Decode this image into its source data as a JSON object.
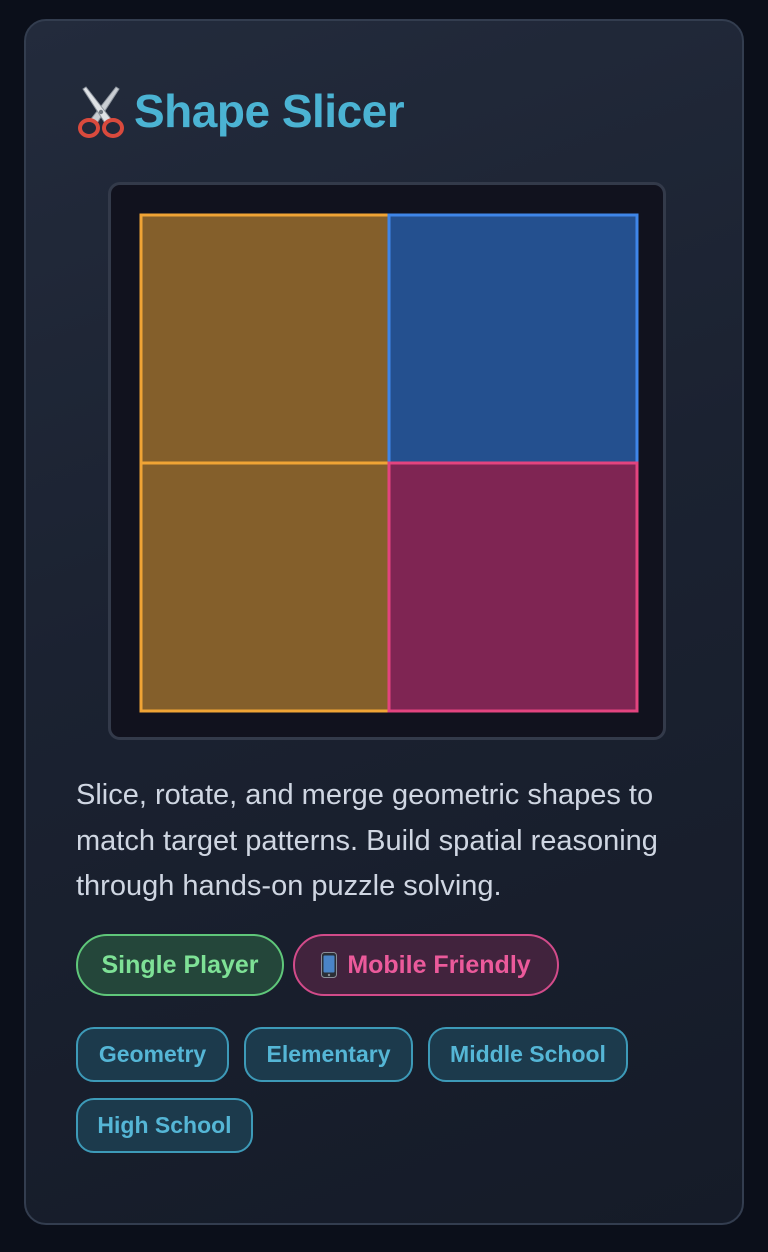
{
  "game": {
    "title": "Shape Slicer",
    "title_icon": "scissors-icon",
    "description": "Slice, rotate, and merge geometric shapes to match target patterns. Build spatial reasoning through hands-on puzzle solving."
  },
  "board": {
    "pieces": [
      {
        "name": "top-left",
        "fill": "#845f2b",
        "stroke": "#f0a435"
      },
      {
        "name": "top-right",
        "fill": "#24508f",
        "stroke": "#3f86e8"
      },
      {
        "name": "bottom-left",
        "fill": "#845f2b",
        "stroke": "#f0a435"
      },
      {
        "name": "bottom-right",
        "fill": "#7f2553",
        "stroke": "#e3447f"
      }
    ]
  },
  "badges": {
    "mode": "Single Player",
    "device": "Mobile Friendly",
    "device_icon": "mobile-phone-icon"
  },
  "tags": [
    "Geometry",
    "Elementary",
    "Middle School",
    "High School"
  ],
  "colors": {
    "accent": "#4bb3d3",
    "mode_badge": "#7ee196",
    "device_badge": "#eb5a9b",
    "tag": "#55b6d6"
  }
}
